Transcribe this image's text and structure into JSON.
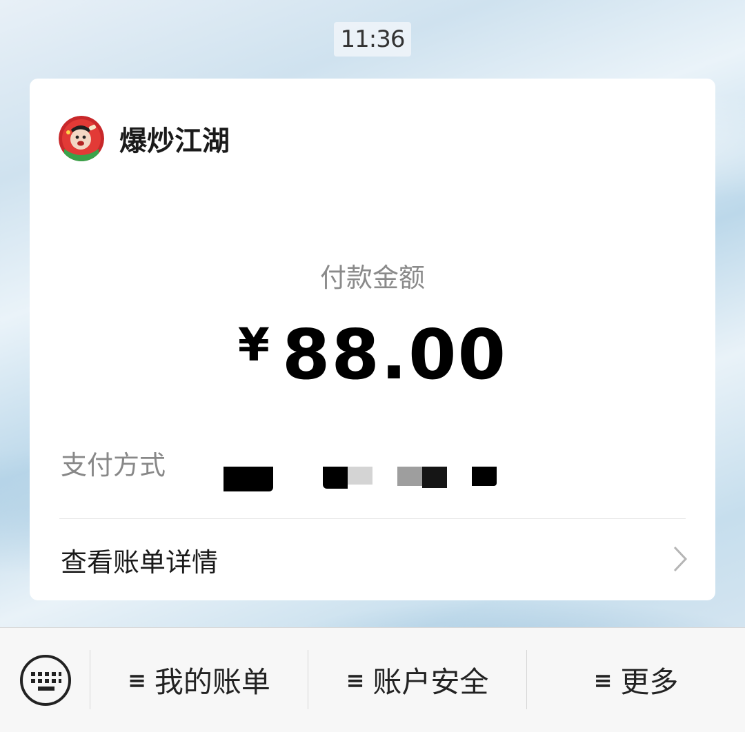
{
  "time": "11:36",
  "merchant": {
    "name": "爆炒江湖"
  },
  "payment": {
    "amount_label": "付款金额",
    "currency_symbol": "¥",
    "amount": "88.00",
    "method_label": "支付方式"
  },
  "bill": {
    "label": "查看账单详情"
  },
  "menu": {
    "items": [
      {
        "label": "我的账单"
      },
      {
        "label": "账户安全"
      },
      {
        "label": "更多"
      }
    ]
  }
}
